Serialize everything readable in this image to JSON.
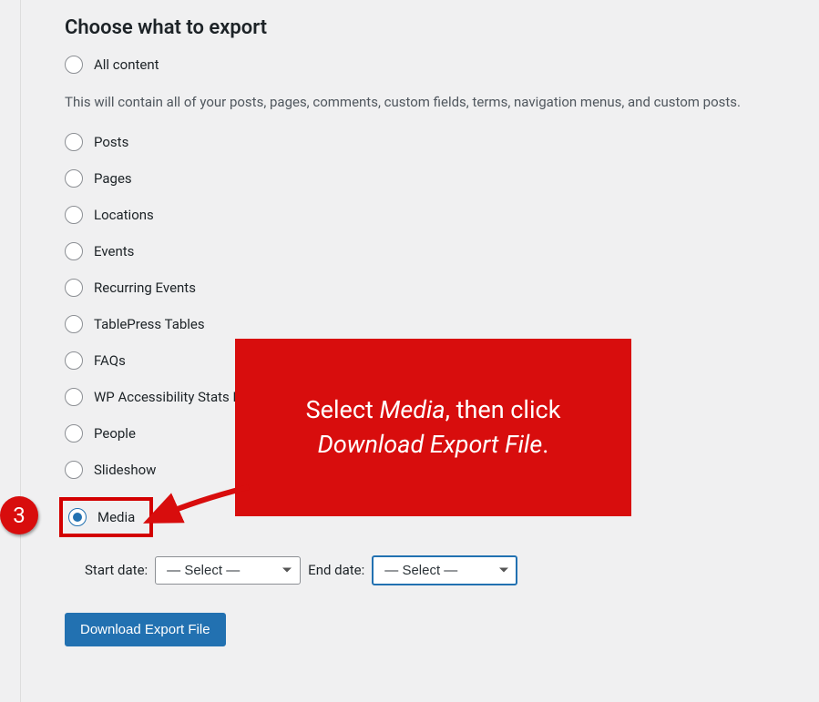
{
  "heading": "Choose what to export",
  "options": {
    "all": "All content",
    "posts": "Posts",
    "pages": "Pages",
    "locations": "Locations",
    "events": "Events",
    "recurring": "Recurring Events",
    "tablepress": "TablePress Tables",
    "faqs": "FAQs",
    "wpaccess": "WP Accessibility Stats Record",
    "people": "People",
    "slideshow": "Slideshow",
    "media": "Media"
  },
  "help_text": "This will contain all of your posts, pages, comments, custom fields, terms, navigation menus, and custom posts.",
  "date": {
    "start_label": "Start date:",
    "end_label": "End date:",
    "start_value": "— Select —",
    "end_value": "— Select —"
  },
  "download_label": "Download Export File",
  "callout": {
    "line1_pre": "Select ",
    "line1_em": "Media",
    "line1_post": ", then click",
    "line2_em": "Download Export File",
    "line2_post": "."
  },
  "step_number": "3"
}
